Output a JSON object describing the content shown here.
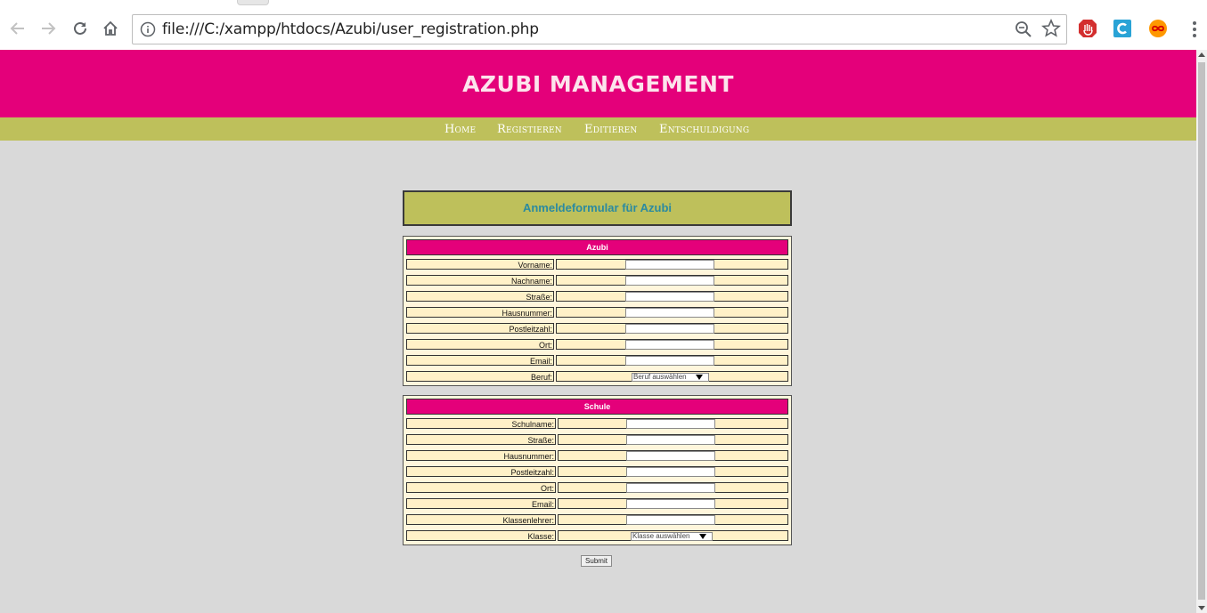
{
  "browser": {
    "url": "file:///C:/xampp/htdocs/Azubi/user_registration.php"
  },
  "page": {
    "title": "AZUBI MANAGEMENT",
    "nav": [
      "Home",
      "Registieren",
      "Editieren",
      "Entschuldigung"
    ],
    "form_heading": "Anmeldeformular für Azubi",
    "azubi": {
      "caption": "Azubi",
      "fields": [
        "Vorname:",
        "Nachname:",
        "Straße:",
        "Hausnummer:",
        "Postleitzahl:",
        "Ort:",
        "Email:"
      ],
      "beruf_label": "Beruf:",
      "beruf_select": "Beruf auswählen"
    },
    "schule": {
      "caption": "Schule",
      "fields": [
        "Schulname:",
        "Straße:",
        "Hausnummer:",
        "Postleitzahl:",
        "Ort:",
        "Email:",
        "Klassenlehrer:"
      ],
      "klasse_label": "Klasse:",
      "klasse_select": "Klasse auswählen"
    },
    "submit_label": "Submit"
  },
  "colors": {
    "banner": "#e4007a",
    "navbar": "#bec05b",
    "background": "#d9d9d9",
    "form_cell": "#fff1c8",
    "heading_text": "#2b8aa0"
  }
}
